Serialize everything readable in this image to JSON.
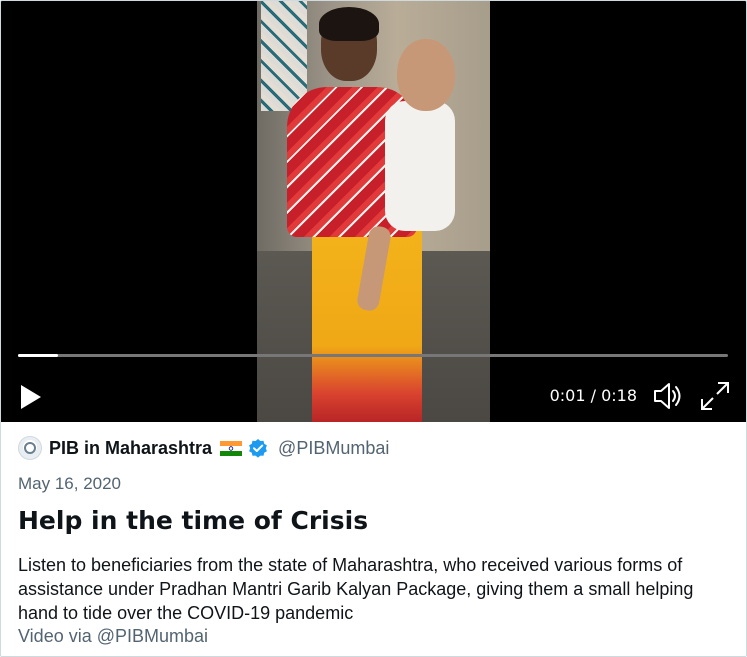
{
  "video": {
    "time_display": "0:01 / 0:18",
    "progress": 0.056,
    "controls": {
      "play_icon": "play-icon",
      "volume_icon": "volume-icon",
      "fullscreen_icon": "fullscreen-icon"
    }
  },
  "author": {
    "name": "PIB in Maharashtra",
    "handle": "@PIBMumbai",
    "flag": "india-flag-icon",
    "verified": "verified-badge-icon"
  },
  "post": {
    "date": "May 16, 2020",
    "title": "Help in the time of Crisis",
    "description": "Listen to beneficiaries from the state of Maharashtra, who received various forms of assistance under Pradhan Mantri Garib Kalyan Package, giving them a small helping hand to tide over the COVID-19 pandemic",
    "via": "Video via @PIBMumbai"
  },
  "colors": {
    "verified_blue": "#1d9bf0",
    "text_primary": "#0f1419",
    "text_secondary": "#536471"
  }
}
